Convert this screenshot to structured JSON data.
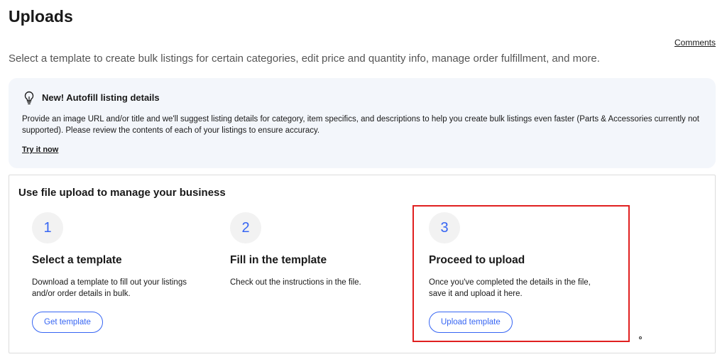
{
  "page": {
    "title": "Uploads",
    "comments_label": "Comments",
    "subtitle": "Select a template to create bulk listings for certain categories, edit price and quantity info, manage order fulfillment, and more."
  },
  "info_card": {
    "icon": "lightbulb-icon",
    "title": "New! Autofill listing details",
    "body": "Provide an image URL and/or title and we'll suggest listing details for category, item specifics, and descriptions to help you create bulk listings even faster (Parts & Accessories currently not supported). Please review the contents of each of your listings to ensure accuracy.",
    "link_label": "Try it now"
  },
  "steps_section": {
    "heading": "Use file upload to manage your business",
    "steps": [
      {
        "number": "1",
        "title": "Select a template",
        "description": "Download a template to fill out your listings and/or order details in bulk.",
        "button_label": "Get template"
      },
      {
        "number": "2",
        "title": "Fill in the template",
        "description": "Check out the instructions in the file.",
        "button_label": ""
      },
      {
        "number": "3",
        "title": "Proceed to upload",
        "description": "Once you've completed the details in the file, save it and upload it here.",
        "button_label": "Upload template"
      }
    ]
  },
  "colors": {
    "accent": "#3665f3",
    "highlight": "#e02020",
    "info_bg": "#f3f6fb"
  }
}
